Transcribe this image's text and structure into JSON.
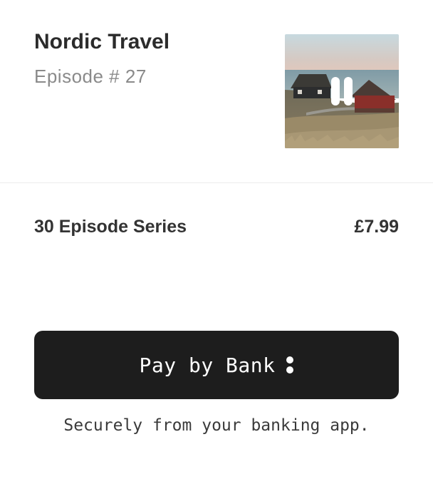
{
  "podcast": {
    "title": "Nordic Travel",
    "episode_label": "Episode # 27",
    "cover_image": "nordic-coastal-cabins-photo",
    "playback_icon": "pause-icon"
  },
  "purchase": {
    "series_label": "30 Episode Series",
    "price": "£7.99"
  },
  "payment": {
    "button_label": "Pay by Bank",
    "button_icon": "colon-icon",
    "subtext": "Securely from your banking app.",
    "button_color": "#1d1d1d"
  }
}
